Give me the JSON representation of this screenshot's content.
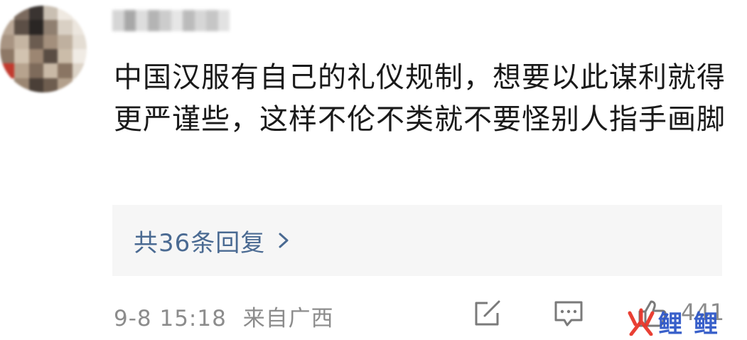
{
  "comment": {
    "text": "中国汉服有自己的礼仪规制，想要以此谋利就得更严谨些，这样不伦不类就不要怪别人指手画脚"
  },
  "replies": {
    "label": "共36条回复",
    "icon": "chevron-right-icon"
  },
  "meta": {
    "time": "9-8 15:18",
    "location": "来自广西"
  },
  "actions": {
    "edit_icon": "edit-icon",
    "comment_icon": "comment-icon",
    "like_icon": "thumbs-up-icon",
    "like_count": "441"
  },
  "watermark": {
    "text": "鲤  鲤"
  },
  "colors": {
    "text": "#1a1a1a",
    "link": "#4a6a92",
    "meta": "#8c8c8c",
    "box_bg": "#f6f6f6",
    "watermark_blue": "#2f58c8",
    "watermark_red": "#e8362a"
  }
}
